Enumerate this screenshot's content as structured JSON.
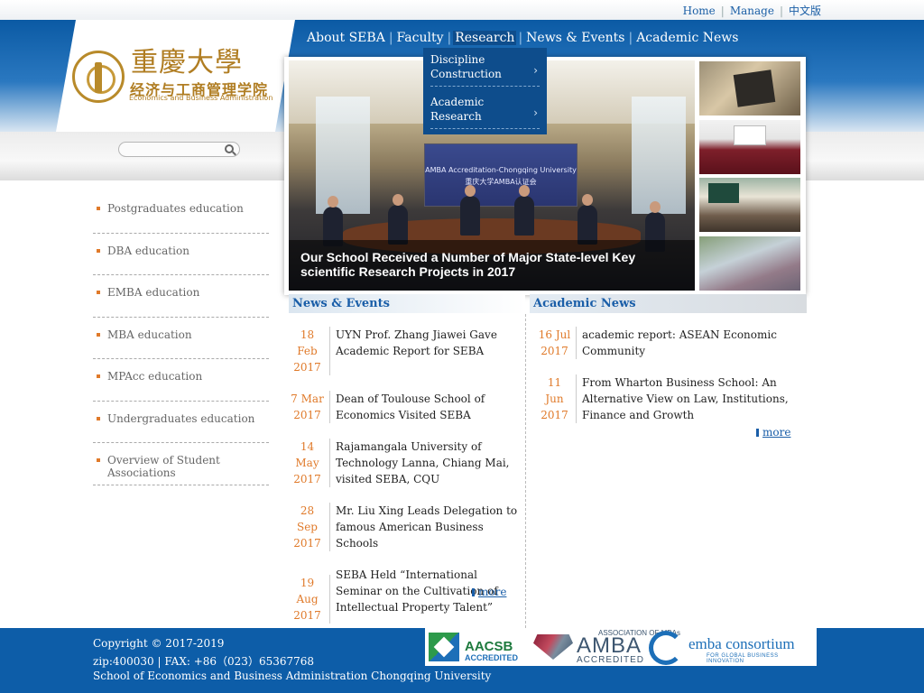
{
  "top_links": [
    "Home",
    "Manage",
    "中文版"
  ],
  "logo": {
    "calligraphy": "重慶大學",
    "name_cn": "经济与工商管理学院",
    "name_en": "Economics and Business Administration"
  },
  "search": {
    "placeholder": ""
  },
  "nav": [
    "About SEBA",
    "Faculty",
    "Research",
    "News & Events",
    "Academic News"
  ],
  "nav_active": "Research",
  "dropdown": [
    "Discipline Construction",
    "Academic Research"
  ],
  "slideshow": {
    "caption": "Our School Received a Number of Major State-level Key scientific Research Projects in 2017",
    "banner_line1": "AMBA Accreditation-Chongqing University",
    "banner_line2": "重庆大学AMBA认证会"
  },
  "sidebar": [
    "Postgraduates education",
    "DBA education",
    "EMBA education",
    "MBA education",
    "MPAcc education",
    "Undergraduates education",
    "Overview of Student Associations"
  ],
  "news": {
    "heading": "News & Events",
    "items": [
      {
        "day": "18 Feb",
        "year": "2017",
        "title": "UYN Prof. Zhang Jiawei Gave Academic Report for SEBA"
      },
      {
        "day": "7 Mar",
        "year": "2017",
        "title": "Dean of Toulouse School of Economics Visited SEBA"
      },
      {
        "day": "14 May",
        "year": "2017",
        "title": "Rajamangala University of Technology Lanna, Chiang Mai, visited SEBA, CQU"
      },
      {
        "day": "28 Sep",
        "year": "2017",
        "title": "Mr. Liu Xing Leads Delegation to famous American Business Schools"
      },
      {
        "day": "19 Aug",
        "year": "2017",
        "title": "SEBA Held “International Seminar on the Cultivation of Intellectual Property Talent”"
      }
    ],
    "more": "more"
  },
  "academic": {
    "heading": "Academic News",
    "items": [
      {
        "day": "16 Jul",
        "year": "2017",
        "title": "academic report: ASEAN Economic Community"
      },
      {
        "day": "11 Jun",
        "year": "2017",
        "title": "From Wharton Business School: An Alternative View on Law, Institutions, Finance and Growth"
      }
    ],
    "more": "more"
  },
  "footer": {
    "copyright": "Copyright © 2017-2019",
    "contact": "zip:400030 | FAX: +86（023）65367768",
    "school": "School of Economics and Business Administration Chongqing University"
  },
  "accreditations": {
    "aacsb": "AACSB",
    "aacsb_sub": "ACCREDITED",
    "amba_assoc": "ASSOCIATION OF MBAs",
    "amba": "AMBA",
    "amba_sub": "ACCREDITED",
    "emba": "emba consortium",
    "emba_sub": "FOR GLOBAL BUSINESS INNOVATION"
  },
  "colors": {
    "brand_blue": "#0d5da8",
    "nav_active_bg": "#0e4d8c",
    "date_orange": "#e07a2a",
    "logo_gold": "#b07d22"
  }
}
